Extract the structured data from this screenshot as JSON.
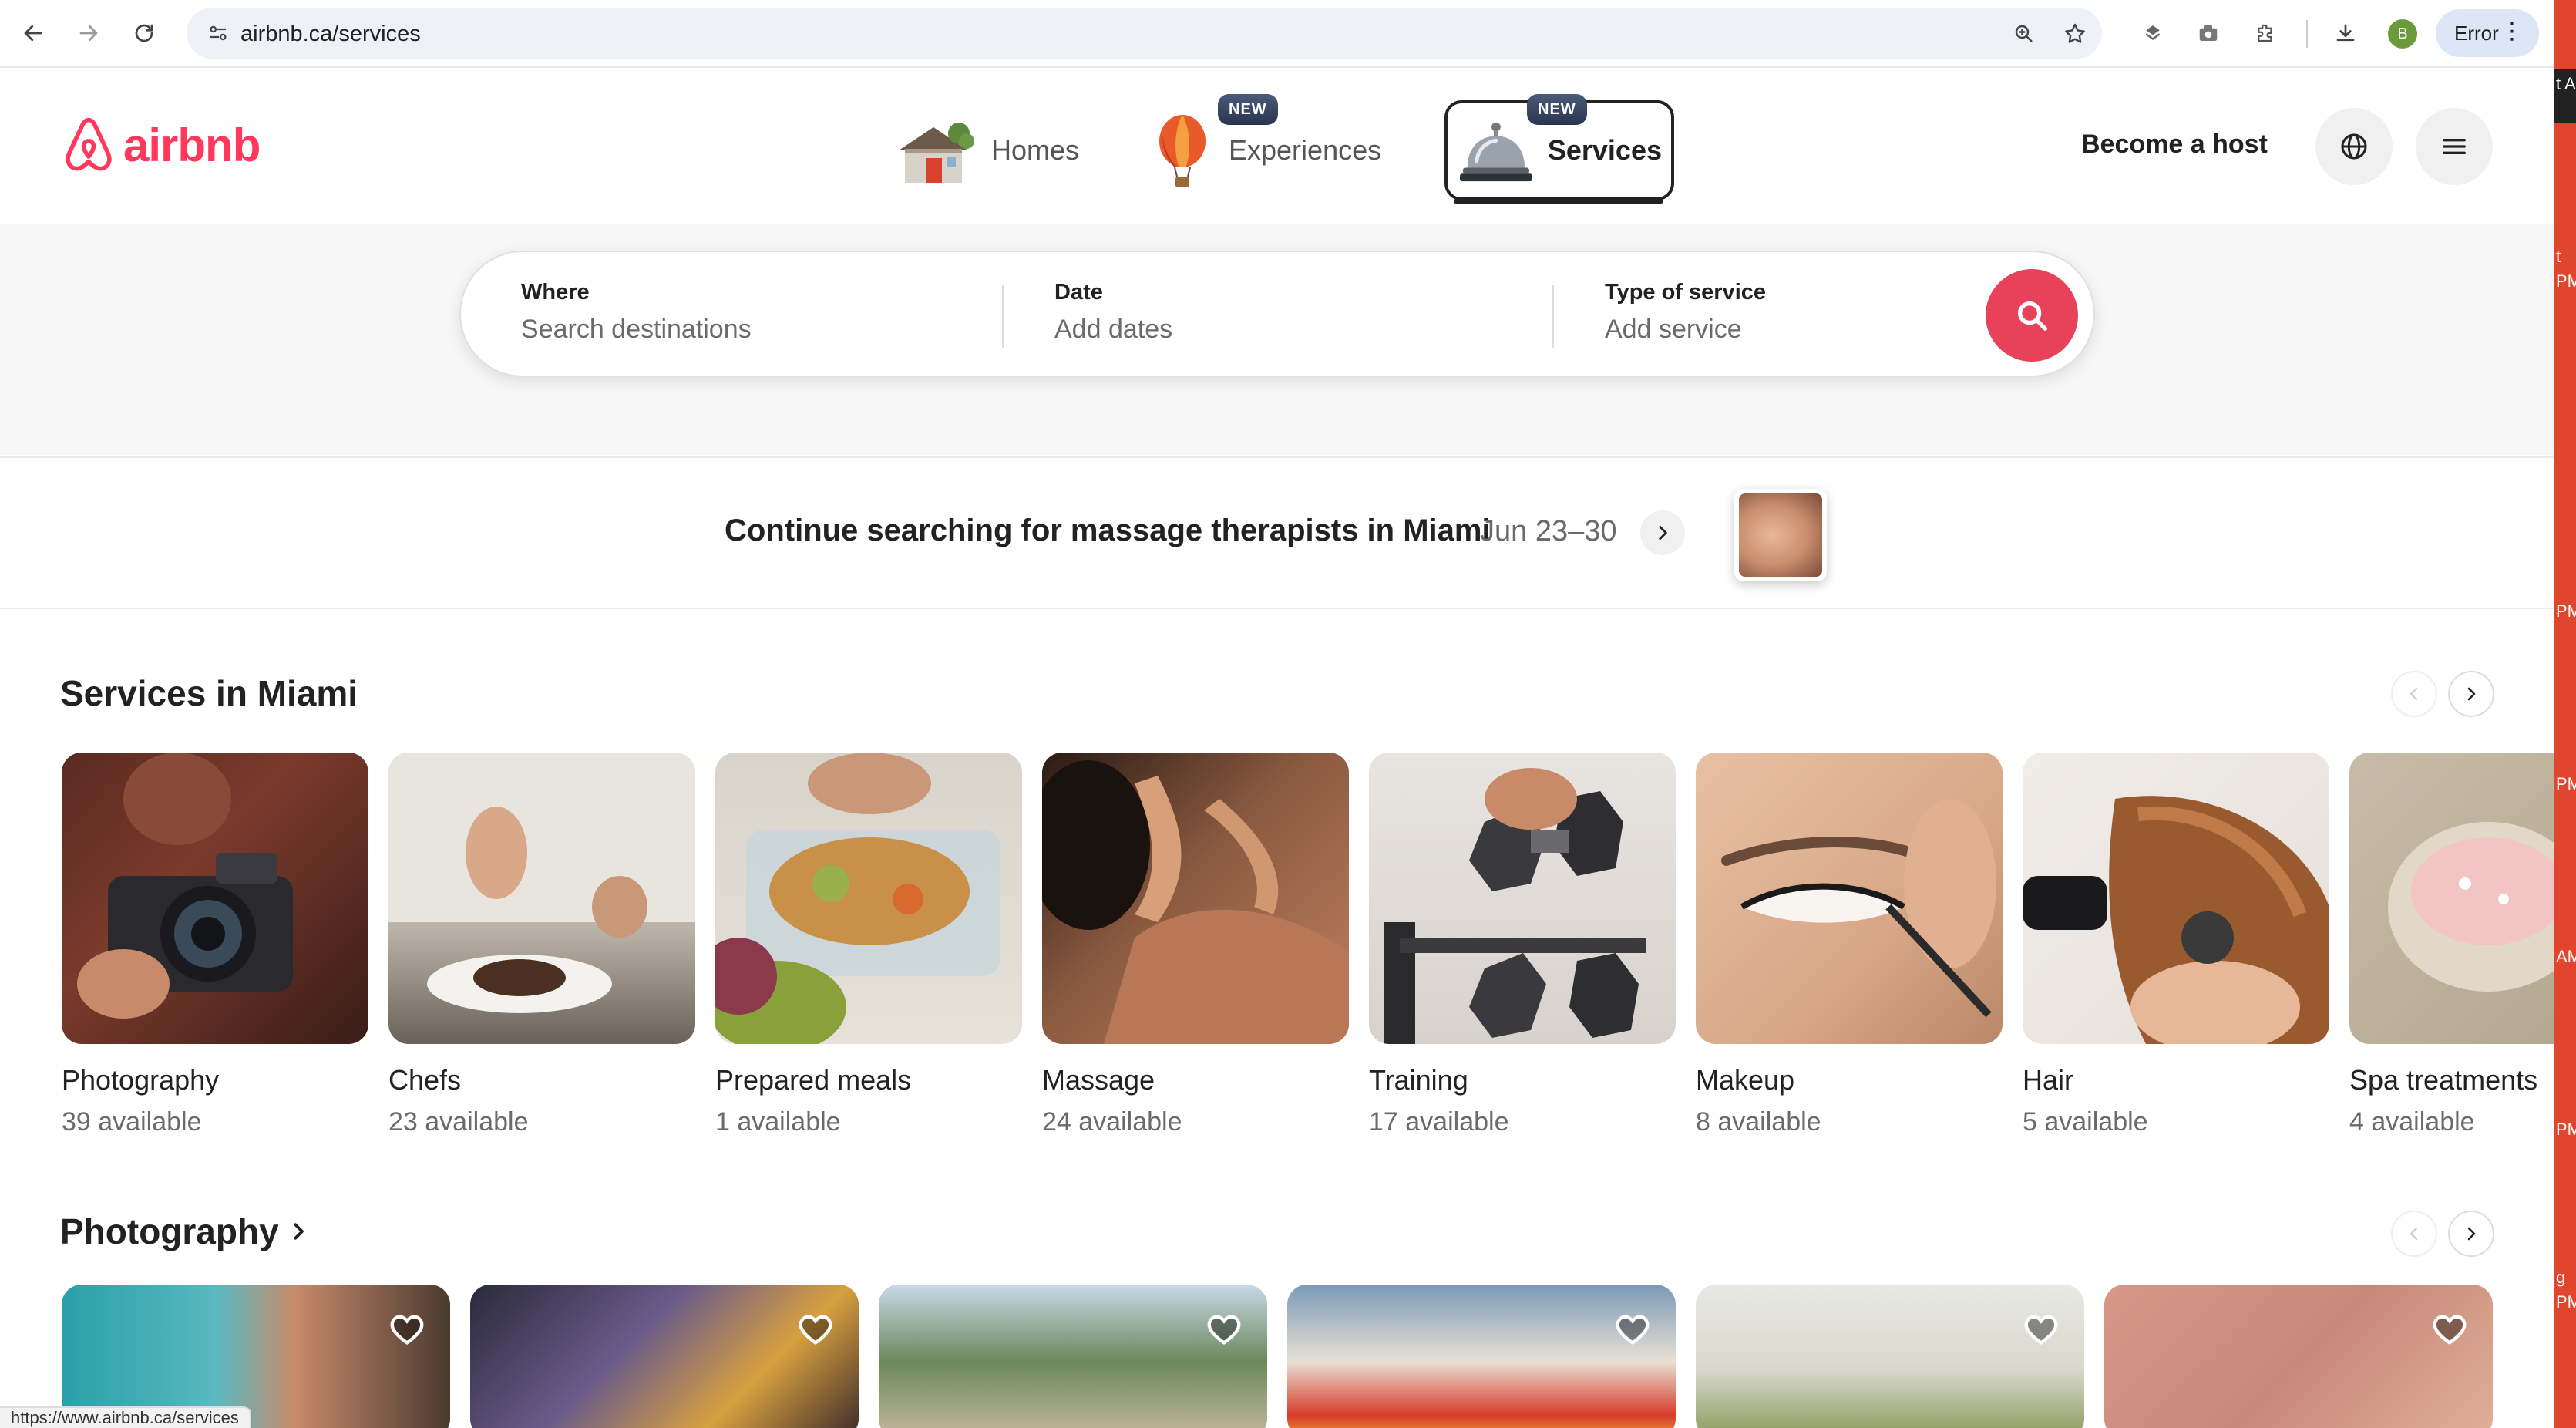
{
  "browser": {
    "url": "airbnb.ca/services",
    "error_label": "Error",
    "profile_initial": "B",
    "status_url": "https://www.airbnb.ca/services"
  },
  "header": {
    "logo_text": "airbnb",
    "tabs": [
      {
        "label": "Homes",
        "badge": ""
      },
      {
        "label": "Experiences",
        "badge": "NEW"
      },
      {
        "label": "Services",
        "badge": "NEW"
      }
    ],
    "become_host": "Become a host"
  },
  "search": {
    "where_label": "Where",
    "where_placeholder": "Search destinations",
    "date_label": "Date",
    "date_placeholder": "Add dates",
    "type_label": "Type of service",
    "type_placeholder": "Add service"
  },
  "continue": {
    "text": "Continue searching for massage therapists in Miami",
    "dates": "Jun 23–30"
  },
  "services_section": {
    "title": "Services in Miami",
    "items": [
      {
        "name": "Photography",
        "count": "39 available"
      },
      {
        "name": "Chefs",
        "count": "23 available"
      },
      {
        "name": "Prepared meals",
        "count": "1 available"
      },
      {
        "name": "Massage",
        "count": "24 available"
      },
      {
        "name": "Training",
        "count": "17 available"
      },
      {
        "name": "Makeup",
        "count": "8 available"
      },
      {
        "name": "Hair",
        "count": "5 available"
      },
      {
        "name": "Spa treatments",
        "count": "4 available"
      }
    ]
  },
  "photography_section": {
    "title": "Photography"
  },
  "colors": {
    "brand": "#ff385c",
    "search_button": "#e8415a"
  },
  "right_strip": [
    "t A",
    "t",
    "PM",
    "PM",
    "PM",
    "AM",
    "PM",
    "g",
    "PM"
  ]
}
